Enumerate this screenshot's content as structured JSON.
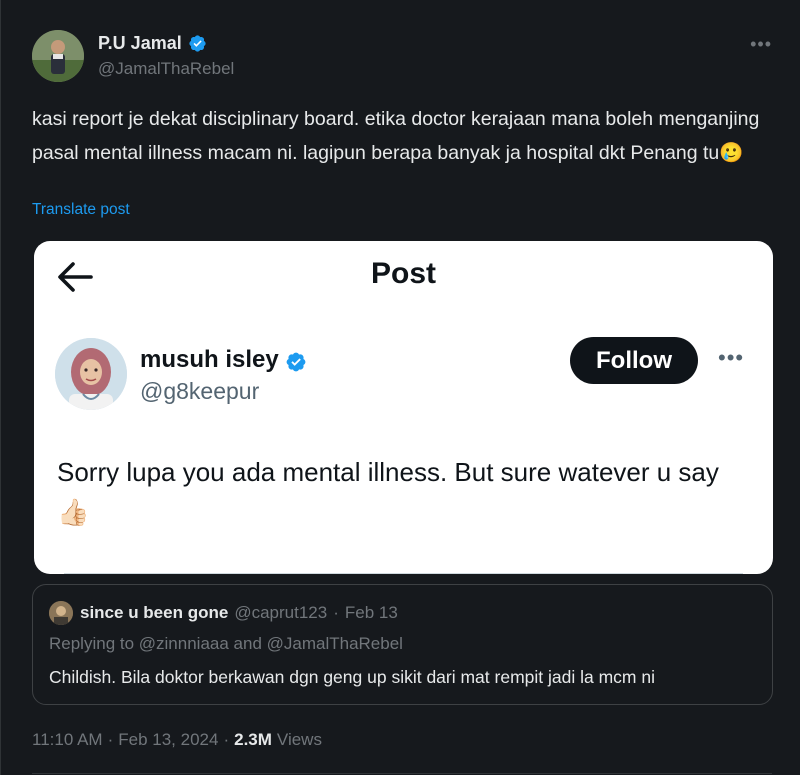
{
  "author": {
    "display_name": "P.U Jamal",
    "handle": "@JamalThaRebel"
  },
  "tweet": {
    "text": "kasi report je dekat disciplinary board. etika doctor kerajaan mana boleh menganjing pasal mental illness macam ni. lagipun berapa banyak ja hospital dkt Penang tu",
    "emoji": "🥲",
    "translate_label": "Translate post"
  },
  "embedded_screenshot": {
    "header_title": "Post",
    "name": "musuh isley",
    "handle": "@g8keepur",
    "follow_label": "Follow",
    "text": "Sorry lupa you ada mental illness. But sure watever u say",
    "emoji": "👍🏻"
  },
  "quoted_tweet": {
    "name": "since u been gone",
    "handle": "@caprut123",
    "separator": "·",
    "date": "Feb 13",
    "replying_to": "Replying to @zinnniaaa and @JamalThaRebel",
    "text": "Childish. Bila doktor berkawan dgn geng up sikit dari mat rempit jadi la mcm ni"
  },
  "meta": {
    "time": "11:10 AM",
    "separator": "·",
    "date": "Feb 13, 2024",
    "separator2": "·",
    "views_count": "2.3M",
    "views_label": "Views"
  },
  "icons": {
    "more": "more-horizontal-icon",
    "verified": "verified-badge-icon",
    "back": "back-arrow-icon"
  },
  "colors": {
    "background": "#16191d",
    "link": "#1d9bf0",
    "verified": "#1d9bf0",
    "muted": "#71767b"
  }
}
